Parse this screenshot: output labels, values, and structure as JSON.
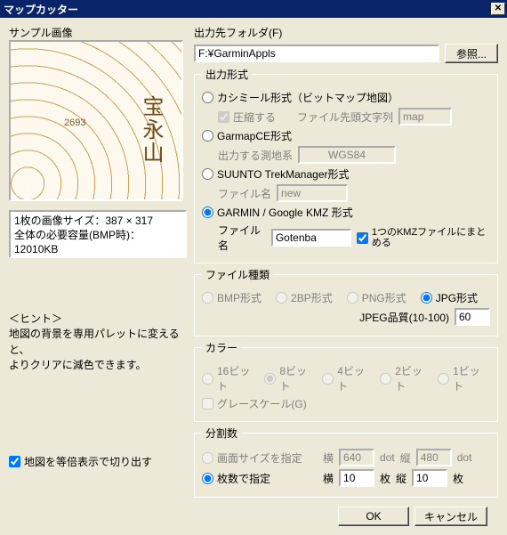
{
  "window": {
    "title": "マップカッター"
  },
  "left": {
    "sample_label": "サンプル画像",
    "map_text1": "宝永山",
    "map_text2": "2693",
    "info_line1": "1枚の画像サイズ：387 × 317",
    "info_line2": "全体の必要容量(BMP時)：12010KB",
    "hint_title": "＜ヒント＞",
    "hint_body1": "地図の背景を専用パレットに変えると、",
    "hint_body2": "よりクリアに減色できます。",
    "equal_scale": "地図を等倍表示で切り出す"
  },
  "folder": {
    "label": "出力先フォルダ(F)",
    "value": "F:¥GarminAppls",
    "browse": "参照..."
  },
  "format": {
    "legend": "出力形式",
    "kashmir": "カシミール形式（ビットマップ地図）",
    "compress": "圧縮する",
    "prefix_label": "ファイル先頭文字列",
    "prefix_value": "map",
    "garmapce": "GarmapCE形式",
    "datum_label": "出力する測地系",
    "datum_value": "WGS84",
    "suunto": "SUUNTO TrekManager形式",
    "filename_label": "ファイル名",
    "suunto_filename": "new",
    "kmz": "GARMIN / Google KMZ 形式",
    "kmz_filename_label": "ファイル名",
    "kmz_filename": "Gotenba",
    "kmz_single": "1つのKMZファイルにまとめる"
  },
  "filetype": {
    "legend": "ファイル種類",
    "bmp": "BMP形式",
    "bmp2": "2BP形式",
    "png": "PNG形式",
    "jpg": "JPG形式",
    "jpeg_quality_label": "JPEG品質(10-100)",
    "jpeg_quality": "60"
  },
  "color": {
    "legend": "カラー",
    "c16": "16ビット",
    "c8": "8ビット",
    "c4": "4ビット",
    "c2": "2ビット",
    "c1": "1ビット",
    "grayscale": "グレースケール(G)"
  },
  "split": {
    "legend": "分割数",
    "by_screen": "画面サイズを指定",
    "by_count": "枚数で指定",
    "h": "横",
    "v": "縦",
    "dot": "dot",
    "mai": "枚",
    "hpx": "640",
    "vpx": "480",
    "hn": "10",
    "vn": "10"
  },
  "buttons": {
    "ok": "OK",
    "cancel": "キャンセル"
  }
}
